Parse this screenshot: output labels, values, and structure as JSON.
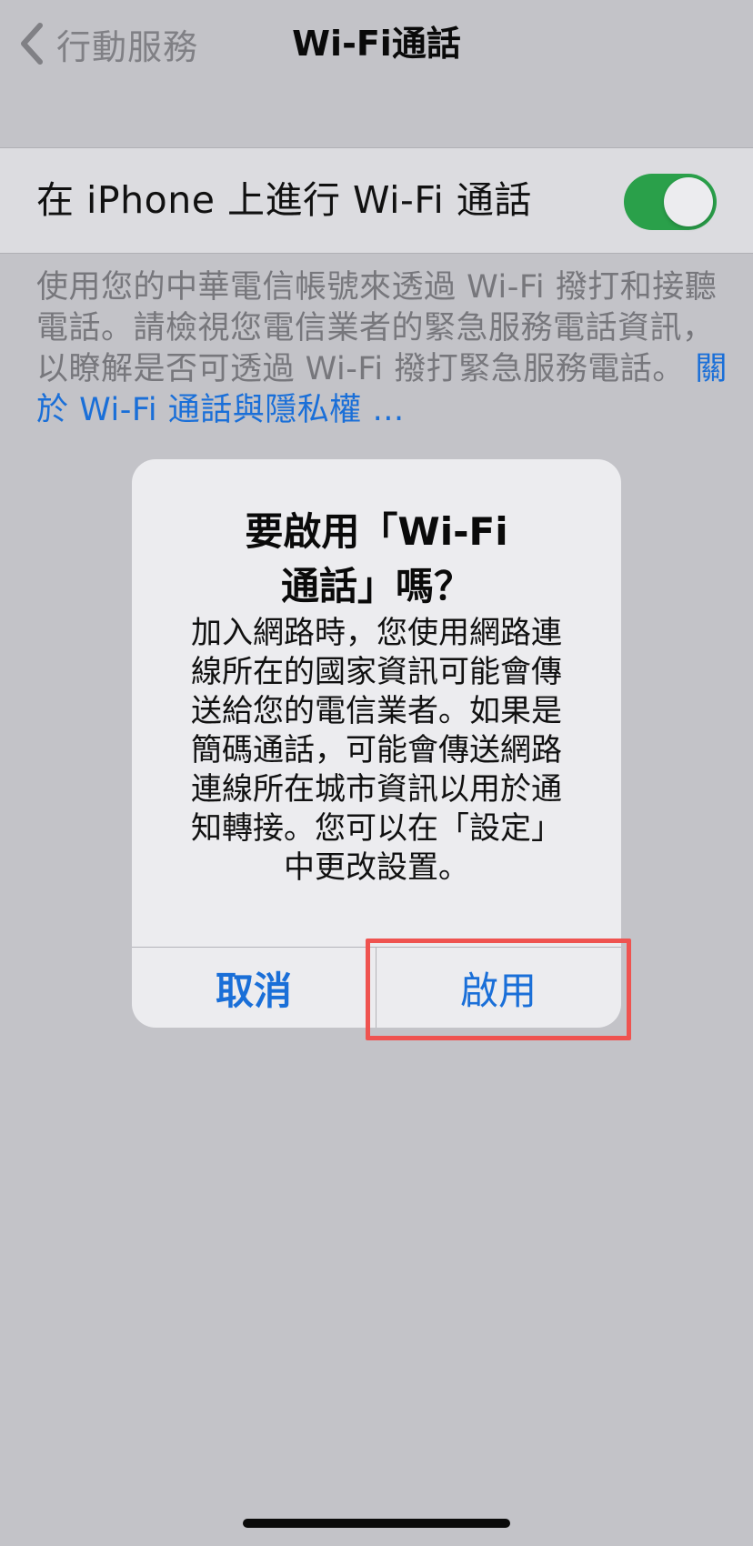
{
  "navbar": {
    "back_label": "行動服務",
    "title": "Wi-Fi通話"
  },
  "settings": {
    "toggle_label": "在 iPhone 上進行 Wi-Fi 通話",
    "toggle_on": true,
    "toggle_color": "#2aa04a",
    "footer_text": "使用您的中華電信帳號來透過 Wi-Fi 撥打和接聽電話。請檢視您電信業者的緊急服務電話資訊，以瞭解是否可透過 Wi-Fi 撥打緊急服務電話。",
    "footer_link": "關於 Wi-Fi 通話與隱私權 …"
  },
  "alert": {
    "title_line1": "要啟用「Wi-Fi",
    "title_line2": "通話」嗎？",
    "message_lines": [
      "加入網路時，您使用網路連",
      "線所在的國家資訊可能會傳",
      "送給您的電信業者。如果是",
      "簡碼通話，可能會傳送網路",
      "連線所在城市資訊以用於通",
      "知轉接。您可以在「設定」",
      "中更改設置。"
    ],
    "cancel_label": "取消",
    "confirm_label": "啟用"
  },
  "colors": {
    "accent": "#1a6fd8",
    "highlight": "#ef5350",
    "background": "#c3c3c8"
  }
}
